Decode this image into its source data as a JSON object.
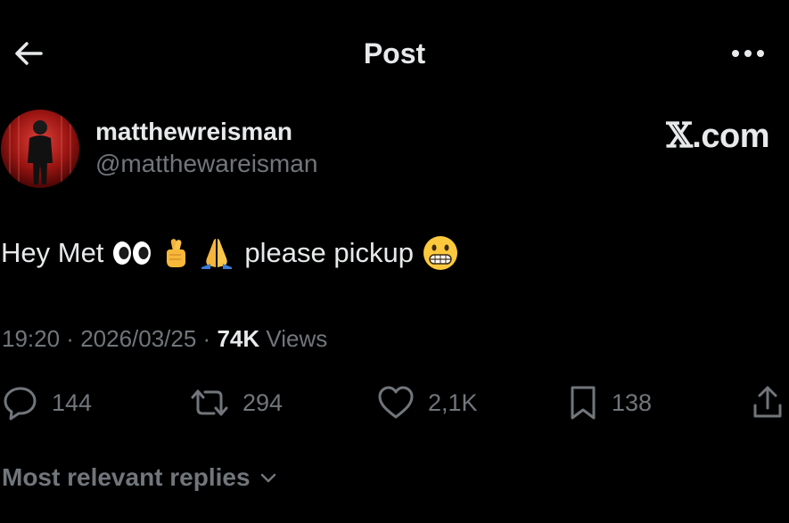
{
  "header": {
    "title": "Post",
    "back_icon": "arrow-left-icon",
    "more_icon": "more-horizontal-icon"
  },
  "author": {
    "display_name": "matthewreisman",
    "handle": "@matthewareisman",
    "avatar_icon": "avatar"
  },
  "watermark": {
    "mark": "𝕏",
    "text": ".com"
  },
  "tweet": {
    "text_before": "Hey Met",
    "text_after": "please pickup",
    "emojis": [
      "eyes-emoji",
      "crossed-fingers-emoji",
      "folded-hands-emoji",
      "grimacing-face-emoji"
    ]
  },
  "meta": {
    "time": "19:20",
    "sep1": " · ",
    "date": "2026/03/25",
    "sep2": " · ",
    "views_count": "74K",
    "views_label": " Views"
  },
  "actions": {
    "replies": "144",
    "reposts": "294",
    "likes": "2,1K",
    "bookmarks": "138"
  },
  "replies_filter": {
    "label": "Most relevant replies",
    "icon": "chevron-down-icon"
  },
  "colors": {
    "background": "#000000",
    "primary_text": "#e7e9ea",
    "secondary_text": "#71767b"
  }
}
